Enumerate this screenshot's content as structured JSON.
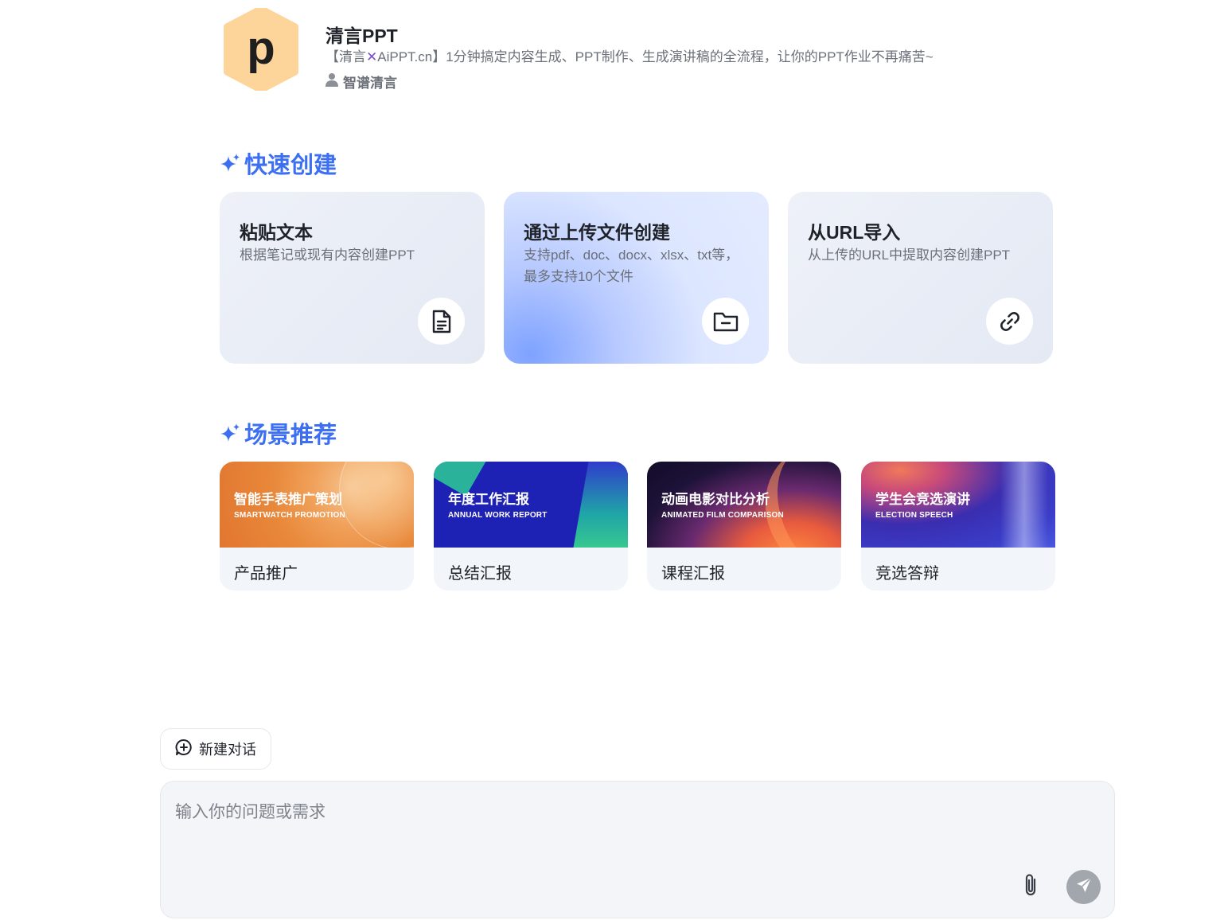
{
  "app": {
    "title": "清言PPT",
    "description_prefix": "【清言",
    "description_mark": "✕",
    "description_suffix": "AiPPT.cn】1分钟搞定内容生成、PPT制作、生成演讲稿的全流程，让你的PPT作业不再痛苦~",
    "author": "智谱清言",
    "logo_letter": "p",
    "logo_color": "#fdd49a"
  },
  "quick_create": {
    "title": "快速创建",
    "cards": [
      {
        "title": "粘贴文本",
        "desc": "根据笔记或现有内容创建PPT",
        "icon": "document-icon"
      },
      {
        "title": "通过上传文件创建",
        "desc": "支持pdf、doc、docx、xlsx、txt等，最多支持10个文件",
        "icon": "folder-icon"
      },
      {
        "title": "从URL导入",
        "desc": "从上传的URL中提取内容创建PPT",
        "icon": "link-icon"
      }
    ]
  },
  "scenarios": {
    "title": "场景推荐",
    "cards": [
      {
        "banner_title": "智能手表推广策划",
        "banner_sub": "SMARTWATCH PROMOTION",
        "label": "产品推广"
      },
      {
        "banner_title": "年度工作汇报",
        "banner_sub": "ANNUAL WORK REPORT",
        "label": "总结汇报"
      },
      {
        "banner_title": "动画电影对比分析",
        "banner_sub": "ANIMATED FILM COMPARISON",
        "label": "课程汇报"
      },
      {
        "banner_title": "学生会竞选演讲",
        "banner_sub": "ELECTION SPEECH",
        "label": "竞选答辩"
      }
    ]
  },
  "chat": {
    "new_chat_label": "新建对话",
    "input_placeholder": "输入你的问题或需求",
    "accent_color": "#3d6ff2"
  }
}
